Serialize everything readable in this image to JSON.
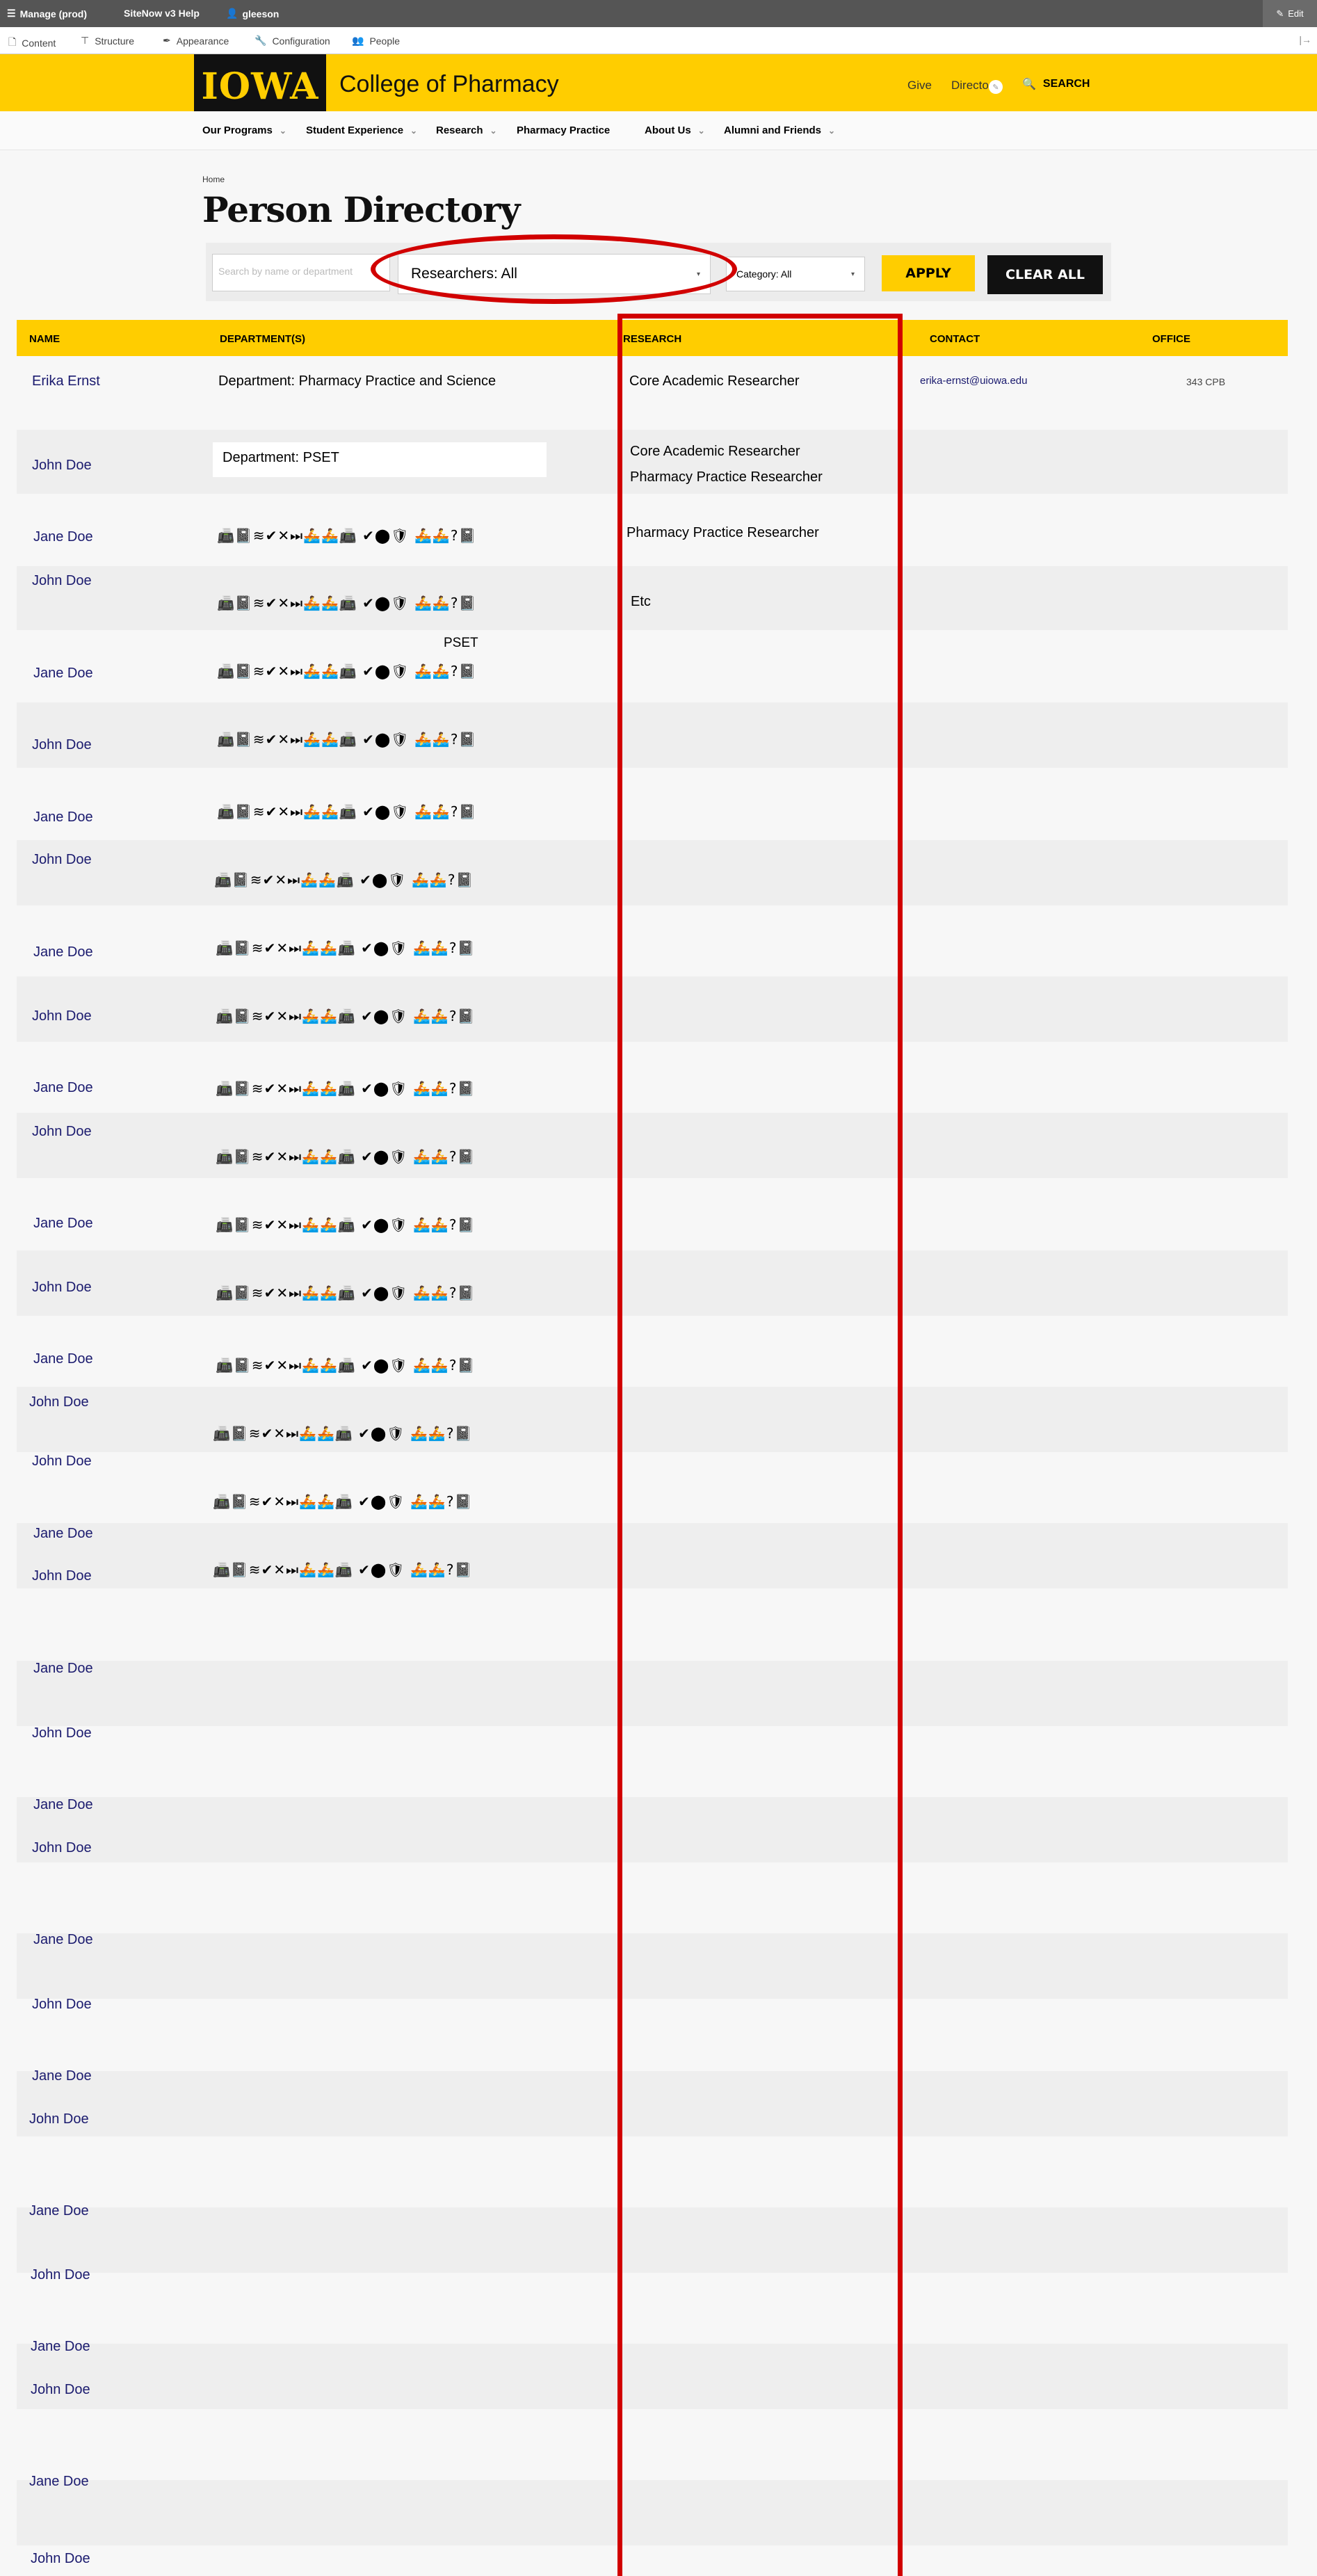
{
  "admin_toolbar": {
    "manage": "Manage (prod)",
    "help": "SiteNow v3 Help",
    "user": "gleeson",
    "edit": "Edit"
  },
  "admin_tabs": [
    "Content",
    "Structure",
    "Appearance",
    "Configuration",
    "People"
  ],
  "site": {
    "logo": "IOWA",
    "college": "College of Pharmacy",
    "give": "Give",
    "directory": "Directo",
    "search": "SEARCH"
  },
  "nav": [
    "Our Programs",
    "Student Experience",
    "Research",
    "Pharmacy Practice",
    "About Us",
    "Alumni and Friends"
  ],
  "breadcrumb": "Home",
  "page_title": "Person Directory",
  "filters": {
    "search_placeholder": "Search by name or department",
    "researchers": "Researchers: All",
    "category": "Category: All",
    "apply": "APPLY",
    "clear": "CLEAR ALL"
  },
  "table": {
    "headers": [
      "NAME",
      "DEPARTMENT(S)",
      "RESEARCH",
      "CONTACT",
      "OFFICE"
    ],
    "row1": {
      "name": "Erika Ernst",
      "dept": "Department: Pharmacy Practice and Science",
      "research": "Core Academic Researcher",
      "contact": "erika-ernst@uiowa.edu",
      "office": "343 CPB"
    },
    "row2": {
      "name": "John Doe",
      "dept": "Department: PSET",
      "research1": "Core Academic Researcher",
      "research2": "Pharmacy Practice Researcher"
    },
    "row3": {
      "name": "Jane Doe",
      "research": "Pharmacy Practice Researcher"
    },
    "row4": {
      "name": "John Doe",
      "research": "Etc"
    },
    "row5": {
      "name": "Jane Doe",
      "note": "PSET"
    },
    "glyph_text": "📠📓≋✔✕⏭🚣🚣📠 ✔⬤🛡 🚣🚣?📓",
    "names": [
      "John Doe",
      "Jane Doe",
      "John Doe",
      "Jane Doe",
      "John Doe",
      "Jane Doe",
      "John Doe",
      "Jane Doe",
      "John Doe",
      "Jane Doe",
      "John Doe",
      "John Doe",
      "Jane Doe",
      "John Doe",
      "Jane Doe",
      "John Doe",
      "Jane Doe",
      "John Doe",
      "Jane Doe",
      "John Doe",
      "Jane Doe",
      "John Doe",
      "Jane Doe",
      "John Doe",
      "Jane Doe",
      "John Doe"
    ]
  }
}
